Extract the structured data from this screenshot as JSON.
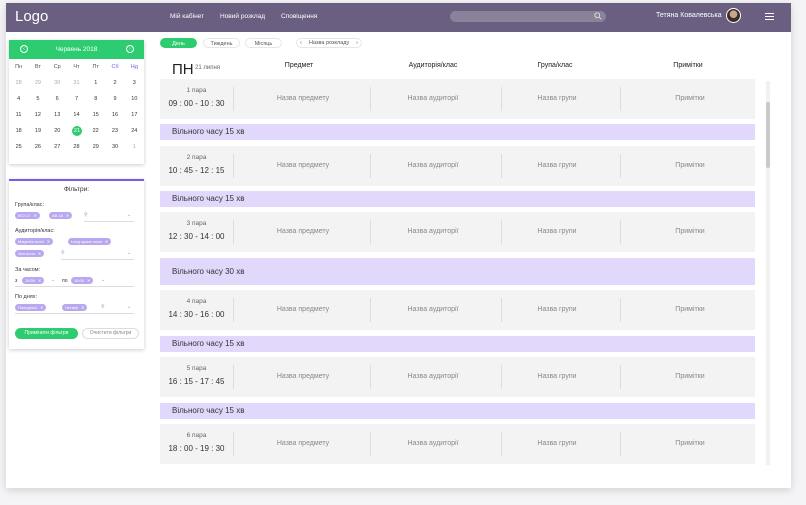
{
  "header": {
    "logo": "Logo",
    "nav": [
      "Мій кабінет",
      "Новий розклад",
      "Сповіщення"
    ],
    "user_name": "Тетяна Ковалевська"
  },
  "calendar": {
    "month_label": "Червень 2018",
    "weekdays": [
      "Пн",
      "Вт",
      "Ср",
      "Чт",
      "Пт",
      "Сб",
      "Нд"
    ],
    "weeks": [
      [
        "28",
        "29",
        "30",
        "31",
        "1",
        "2",
        "3"
      ],
      [
        "4",
        "5",
        "6",
        "7",
        "8",
        "9",
        "10"
      ],
      [
        "11",
        "12",
        "13",
        "14",
        "15",
        "16",
        "17"
      ],
      [
        "18",
        "19",
        "20",
        "21",
        "22",
        "23",
        "24"
      ],
      [
        "25",
        "26",
        "27",
        "28",
        "29",
        "30",
        "1"
      ]
    ],
    "selected": "21"
  },
  "filters": {
    "title": "Фільтри:",
    "group_label": "Група/клас:",
    "group_chips": [
      "ІЕО 17",
      "АВ 16"
    ],
    "room_label": "Аудиторія/клас:",
    "room_chips": [
      "Magenta room",
      "Long space room",
      "Зал поля"
    ],
    "time_label": "За часом:",
    "time_from_prefix": "з",
    "time_from": "15:00",
    "time_to_prefix": "по",
    "time_to": "18:00",
    "day_label": "По днях:",
    "day_chips": [
      "Понеділок",
      "Четвер"
    ],
    "apply": "Примінити фільтри",
    "clear": "Очистити фільтри"
  },
  "view_tabs": [
    "День",
    "Тиждень",
    "Місяць"
  ],
  "subject_selector": {
    "left": "‹",
    "label": "Назва розкладу",
    "right": "›"
  },
  "schedule": {
    "day": "ПН",
    "date": "21 липня",
    "columns": [
      "Предмет",
      "Аудиторія/клас",
      "Група/клас",
      "Примітки"
    ],
    "lessons": [
      {
        "pair": "1 пара",
        "time": "09 : 00 - 10 : 30",
        "subject": "Назва предмету",
        "room": "Назва аудиторії",
        "group": "Назва групи",
        "note": "Примітки"
      },
      {
        "pair": "2 пара",
        "time": "10 : 45 - 12 : 15",
        "subject": "Назва предмету",
        "room": "Назва аудиторії",
        "group": "Назва групи",
        "note": "Примітки"
      },
      {
        "pair": "3 пара",
        "time": "12 : 30 - 14 : 00",
        "subject": "Назва предмету",
        "room": "Назва аудиторії",
        "group": "Назва групи",
        "note": "Примітки"
      },
      {
        "pair": "4 пара",
        "time": "14 : 30 - 16 : 00",
        "subject": "Назва предмету",
        "room": "Назва аудиторії",
        "group": "Назва групи",
        "note": "Примітки"
      },
      {
        "pair": "5 пара",
        "time": "16 : 15 - 17 : 45",
        "subject": "Назва предмету",
        "room": "Назва аудиторії",
        "group": "Назва групи",
        "note": "Примітки"
      },
      {
        "pair": "6 пара",
        "time": "18 : 00 - 19 : 30",
        "subject": "Назва предмету",
        "room": "Назва аудиторії",
        "group": "Назва групи",
        "note": "Примітки"
      }
    ],
    "breaks": [
      "Вільного часу 15 хв",
      "Вільного часу 15 хв",
      "Вільного часу 30 хв",
      "Вільного часу 15 хв",
      "Вільного часу 15 хв"
    ]
  }
}
